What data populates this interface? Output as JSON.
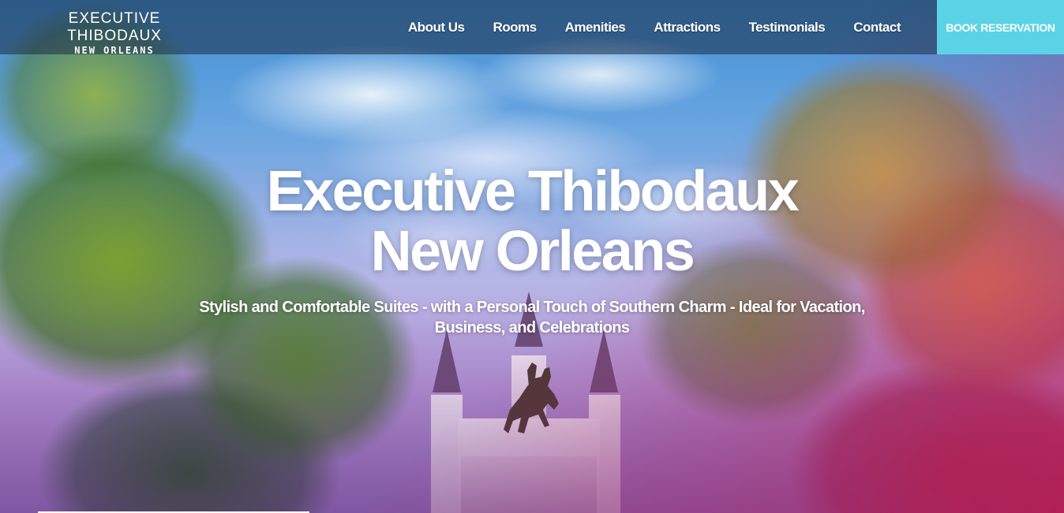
{
  "brand": {
    "line1": "EXECUTIVE THIBODAUX",
    "line2": "NEW ORLEANS"
  },
  "nav": {
    "items": [
      {
        "label": "About Us"
      },
      {
        "label": "Rooms"
      },
      {
        "label": "Amenities"
      },
      {
        "label": "Attractions"
      },
      {
        "label": "Testimonials"
      },
      {
        "label": "Contact"
      }
    ],
    "book_label": "BOOK RESERVATION"
  },
  "hero": {
    "title_line1": "Executive Thibodaux",
    "title_line2": "New Orleans",
    "subtitle": "Stylish and Comfortable Suites - with a Personal Touch of Southern Charm - Ideal for Vacation, Business, and Celebrations"
  },
  "colors": {
    "accent": "#5bd3e6",
    "nav_background": "#1e2d46",
    "text": "#ffffff"
  }
}
